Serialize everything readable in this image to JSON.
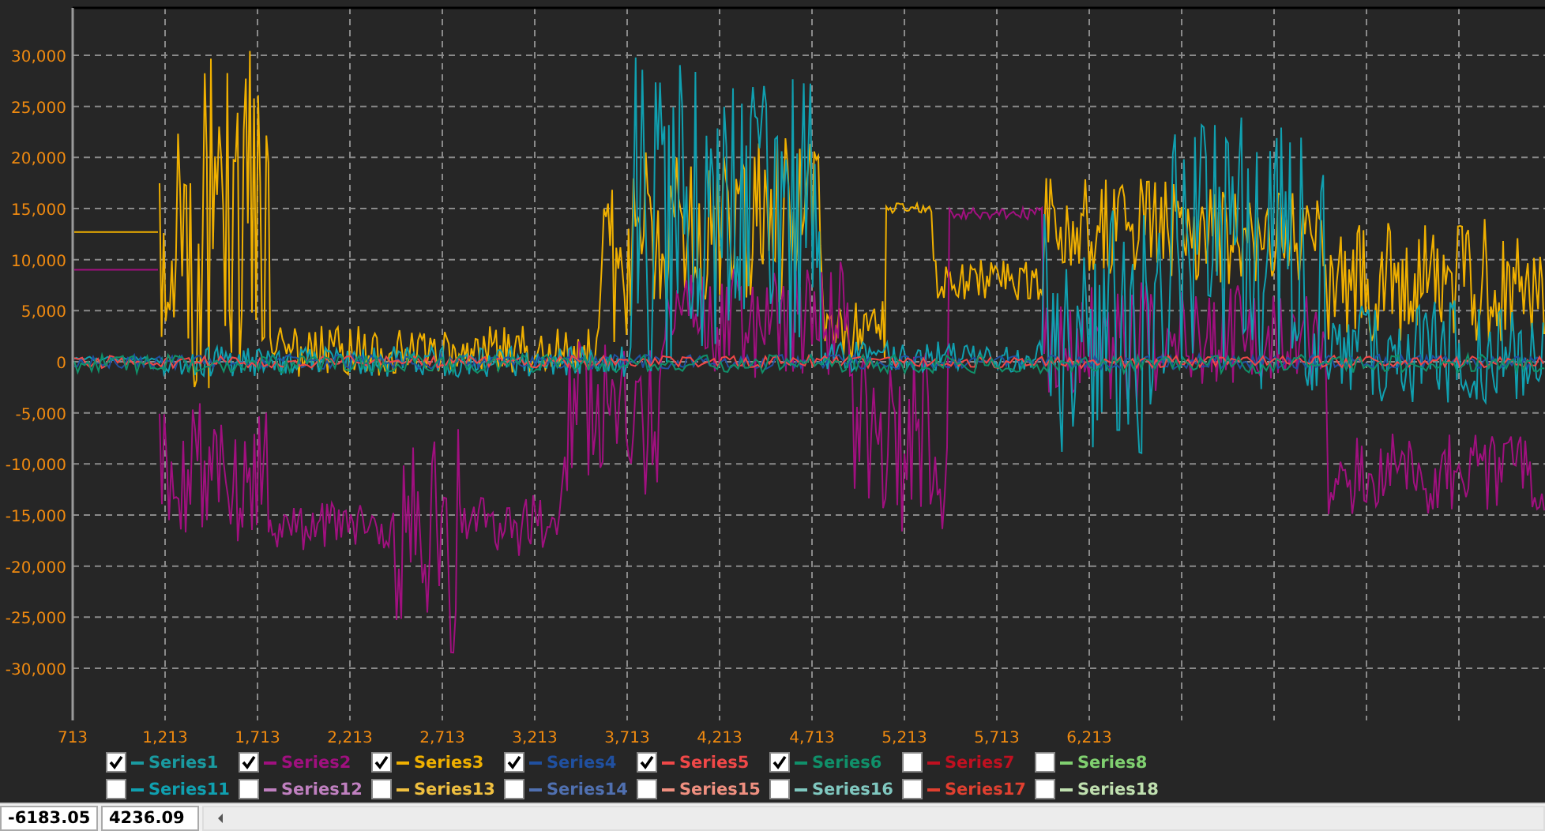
{
  "chart": {
    "y_axis_labels": [
      "30,000",
      "25,000",
      "20,000",
      "15,000",
      "10,000",
      "5,000",
      "0",
      "-5,000",
      "-10,000",
      "-15,000",
      "-20,000",
      "-25,000",
      "-30,000"
    ],
    "x_axis_labels": [
      "713",
      "1,213",
      "1,713",
      "2,213",
      "2,713",
      "3,213",
      "3,713",
      "4,213",
      "4,713",
      "5,213",
      "5,713",
      "6,213"
    ]
  },
  "legend": {
    "rows": [
      [
        {
          "name": "Series1",
          "checked": true,
          "color": "#1a9aa0"
        },
        {
          "name": "Series2",
          "checked": true,
          "color": "#a0107f"
        },
        {
          "name": "Series3",
          "checked": true,
          "color": "#f0b000"
        },
        {
          "name": "Series4",
          "checked": true,
          "color": "#2050a0"
        },
        {
          "name": "Series5",
          "checked": true,
          "color": "#f04848"
        },
        {
          "name": "Series6",
          "checked": true,
          "color": "#10906a"
        },
        {
          "name": "Series7",
          "checked": false,
          "color": "#c01020"
        },
        {
          "name": "Series8",
          "checked": false,
          "color": "#80d070"
        }
      ],
      [
        {
          "name": "Series11",
          "checked": false,
          "color": "#10a0b0"
        },
        {
          "name": "Series12",
          "checked": false,
          "color": "#c080c0"
        },
        {
          "name": "Series13",
          "checked": false,
          "color": "#f0c040"
        },
        {
          "name": "Series14",
          "checked": false,
          "color": "#5070b0"
        },
        {
          "name": "Series15",
          "checked": false,
          "color": "#f09080"
        },
        {
          "name": "Series16",
          "checked": false,
          "color": "#80c8c0"
        },
        {
          "name": "Series17",
          "checked": false,
          "color": "#e04030"
        },
        {
          "name": "Series18",
          "checked": false,
          "color": "#c0e0b0"
        }
      ]
    ]
  },
  "status_bar": {
    "fields": [
      "-6183.05",
      "4236.09"
    ]
  }
}
